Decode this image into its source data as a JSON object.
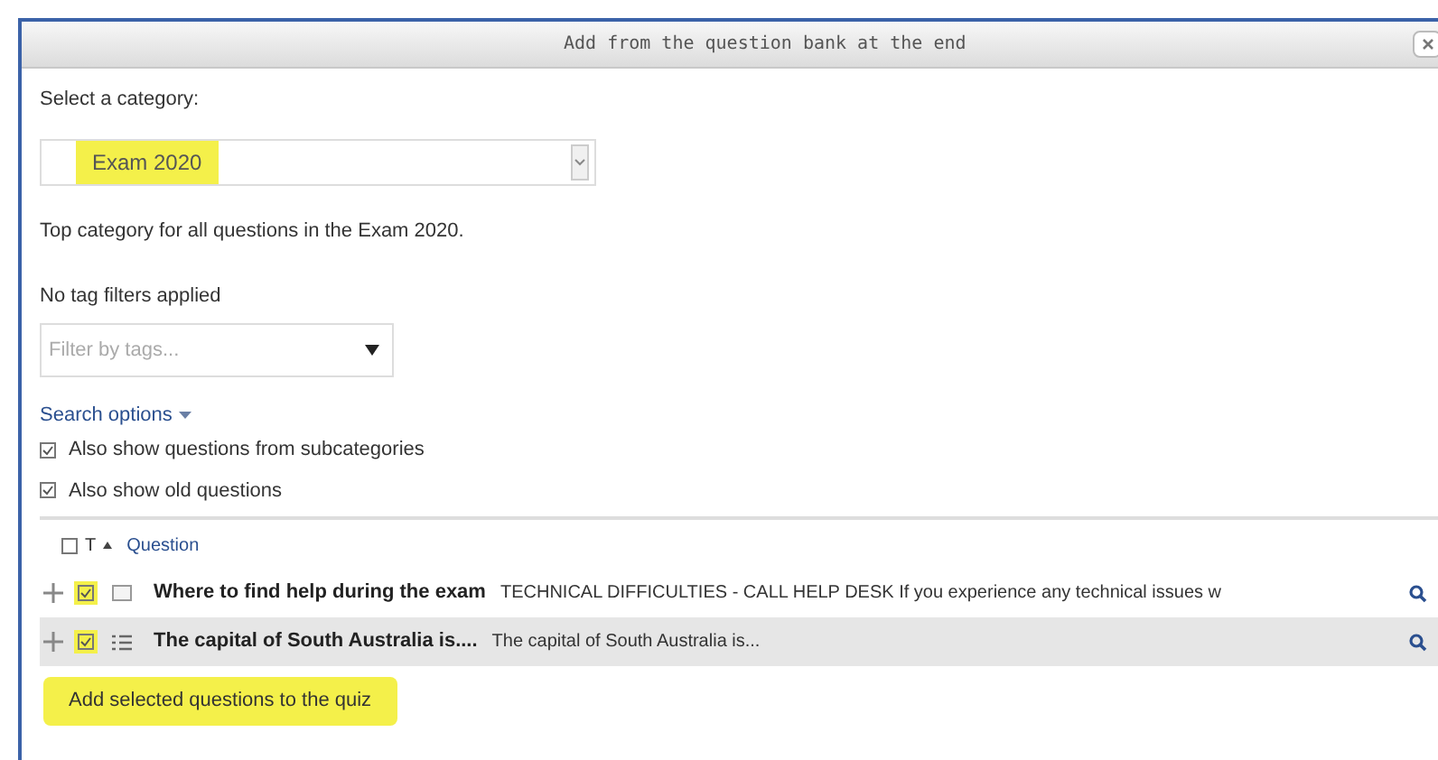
{
  "window": {
    "title": "Add from the question bank at the end"
  },
  "category": {
    "label": "Select a category:",
    "value": "Exam 2020",
    "highlighted": true,
    "description": "Top category for all questions in the Exam 2020."
  },
  "tags": {
    "status": "No tag filters applied",
    "placeholder": "Filter by tags..."
  },
  "search_options": {
    "label": "Search options",
    "options": [
      {
        "label": "Also show questions from subcategories",
        "checked": true
      },
      {
        "label": "Also show old questions",
        "checked": true
      }
    ]
  },
  "table": {
    "select_all_checked": false,
    "type_column": "T",
    "question_column": "Question",
    "rows": [
      {
        "kind": "description",
        "checked": true,
        "highlighted": true,
        "shaded": false,
        "name": "Where to find help during the exam",
        "text": "TECHNICAL DIFFICULTIES - CALL HELP DESK If you experience any technical issues w"
      },
      {
        "kind": "multichoice",
        "checked": true,
        "highlighted": true,
        "shaded": true,
        "name": "The capital of South Australia is....",
        "text": "The capital of South Australia is..."
      }
    ]
  },
  "add_button": {
    "label": "Add selected questions to the quiz",
    "highlighted": true
  }
}
